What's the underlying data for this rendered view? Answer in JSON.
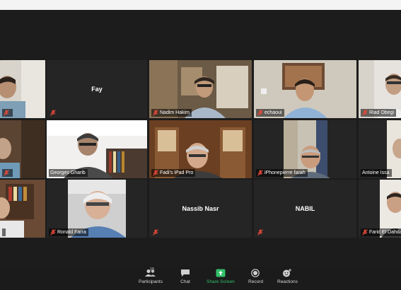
{
  "meeting": {
    "participants": [
      {
        "name": ""
      },
      {
        "name": "Fay"
      },
      {
        "name": "Nadim Hakim"
      },
      {
        "name": "echaoui"
      },
      {
        "name": "Riad Obegi"
      },
      {
        "name": ""
      },
      {
        "name": "Georges Gharib"
      },
      {
        "name": "Fadi's iPad Pro"
      },
      {
        "name": "iPhonepierre farah"
      },
      {
        "name": "Antoine Issa"
      },
      {
        "name": ""
      },
      {
        "name": "Ronald Farra"
      },
      {
        "name": "Nassib Nasr"
      },
      {
        "name": "NABIL"
      },
      {
        "name": "Farid El Dahdah"
      }
    ]
  },
  "toolbar": {
    "participants_label": "Participants",
    "participants_count": "15",
    "chat_label": "Chat",
    "share_label": "Share Screen",
    "record_label": "Record",
    "reactions_label": "Reactions"
  },
  "colors": {
    "active_border": "#9fcf3a",
    "share_green": "#33c16b",
    "muted_red": "#e0483a"
  }
}
